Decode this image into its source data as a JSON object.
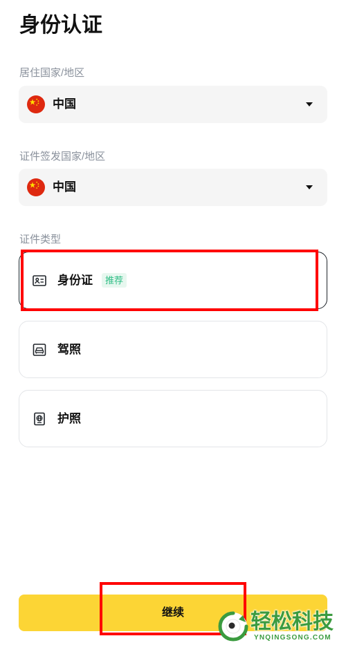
{
  "page": {
    "title": "身份认证"
  },
  "residence": {
    "label": "居住国家/地区",
    "value": "中国",
    "flag_icon": "china-flag-icon"
  },
  "issuing": {
    "label": "证件签发国家/地区",
    "value": "中国",
    "flag_icon": "china-flag-icon"
  },
  "doc_type": {
    "label": "证件类型",
    "options": [
      {
        "label": "身份证",
        "badge": "推荐",
        "icon": "id-card-icon",
        "selected": true
      },
      {
        "label": "驾照",
        "icon": "driver-license-icon",
        "selected": false
      },
      {
        "label": "护照",
        "icon": "passport-icon",
        "selected": false
      }
    ]
  },
  "actions": {
    "continue_label": "继续"
  },
  "watermark": {
    "brand": "轻松科技",
    "domain": "YNQINGSONG.COM"
  },
  "colors": {
    "accent": "#fcd535",
    "badge_text": "#2ebd85",
    "badge_bg": "#e7f7ef",
    "highlight": "#ff0000",
    "select_bg": "#f5f5f5",
    "watermark": "#3b9b3f"
  }
}
